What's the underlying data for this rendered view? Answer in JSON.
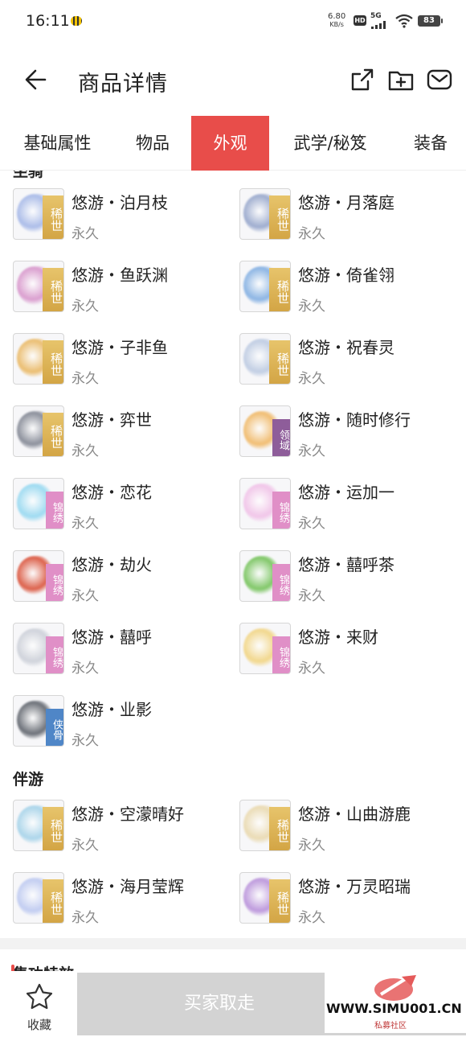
{
  "status": {
    "time": "16:11",
    "net_speed": "6.80",
    "net_unit": "KB/s",
    "hd": "HD",
    "network": "5G",
    "battery": "83"
  },
  "header": {
    "title": "商品详情"
  },
  "tabs": [
    {
      "label": "基础属性",
      "active": false
    },
    {
      "label": "物品",
      "active": false
    },
    {
      "label": "外观",
      "active": true
    },
    {
      "label": "武学/秘笈",
      "active": false
    },
    {
      "label": "装备",
      "active": false
    }
  ],
  "section_top": {
    "title": "坐骑"
  },
  "items": [
    {
      "name": "悠游・泊月枝",
      "duration": "永久",
      "tag": "稀世",
      "tag_type": "xishi",
      "art_color": "#9fb3e6"
    },
    {
      "name": "悠游・月落庭",
      "duration": "永久",
      "tag": "稀世",
      "tag_type": "xishi",
      "art_color": "#8fa0c8"
    },
    {
      "name": "悠游・鱼跃渊",
      "duration": "永久",
      "tag": "稀世",
      "tag_type": "xishi",
      "art_color": "#d58fc8"
    },
    {
      "name": "悠游・倚雀翎",
      "duration": "永久",
      "tag": "稀世",
      "tag_type": "xishi",
      "art_color": "#79a9e0"
    },
    {
      "name": "悠游・子非鱼",
      "duration": "永久",
      "tag": "稀世",
      "tag_type": "xishi",
      "art_color": "#e9b45a"
    },
    {
      "name": "悠游・祝春灵",
      "duration": "永久",
      "tag": "稀世",
      "tag_type": "xishi",
      "art_color": "#b8c7e0"
    },
    {
      "name": "悠游・弈世",
      "duration": "永久",
      "tag": "稀世",
      "tag_type": "xishi",
      "art_color": "#7a7f8c"
    },
    {
      "name": "悠游・随时修行",
      "duration": "永久",
      "tag": "领域",
      "tag_type": "lingyu",
      "art_color": "#f0b45c"
    },
    {
      "name": "悠游・恋花",
      "duration": "永久",
      "tag": "锦绣",
      "tag_type": "jinxiu",
      "art_color": "#8fd6f0"
    },
    {
      "name": "悠游・运加一",
      "duration": "永久",
      "tag": "锦绣",
      "tag_type": "jinxiu",
      "art_color": "#f0bde6"
    },
    {
      "name": "悠游・劫火",
      "duration": "永久",
      "tag": "锦绣",
      "tag_type": "jinxiu",
      "art_color": "#d8482e"
    },
    {
      "name": "悠游・囍呼茶",
      "duration": "永久",
      "tag": "锦绣",
      "tag_type": "jinxiu",
      "art_color": "#6cbf4f"
    },
    {
      "name": "悠游・囍呼",
      "duration": "永久",
      "tag": "锦绣",
      "tag_type": "jinxiu",
      "art_color": "#c9cdd6"
    },
    {
      "name": "悠游・来财",
      "duration": "永久",
      "tag": "锦绣",
      "tag_type": "jinxiu",
      "art_color": "#f1d27a"
    },
    {
      "name": "悠游・业影",
      "duration": "永久",
      "tag": "侠骨",
      "tag_type": "xiagu",
      "art_color": "#555a63"
    }
  ],
  "section_companion": {
    "title": "伴游"
  },
  "companion_items": [
    {
      "name": "悠游・空濛晴好",
      "duration": "永久",
      "tag": "稀世",
      "tag_type": "xishi",
      "art_color": "#9fd0e8"
    },
    {
      "name": "悠游・山曲游鹿",
      "duration": "永久",
      "tag": "稀世",
      "tag_type": "xishi",
      "art_color": "#e8d6a8"
    },
    {
      "name": "悠游・海月莹辉",
      "duration": "永久",
      "tag": "稀世",
      "tag_type": "xishi",
      "art_color": "#b9c6f0"
    },
    {
      "name": "悠游・万灵昭瑞",
      "duration": "永久",
      "tag": "稀世",
      "tag_type": "xishi",
      "art_color": "#b48ad8"
    }
  ],
  "section_next": {
    "title": "集功特效"
  },
  "bottom": {
    "favorite_label": "收藏",
    "buy_label": "买家取走"
  },
  "watermark": {
    "text": "WWW.SIMU001.CN",
    "sub": "私募社区"
  },
  "colors": {
    "accent": "#e84d4a",
    "disabled_button": "#d3d3d3"
  }
}
